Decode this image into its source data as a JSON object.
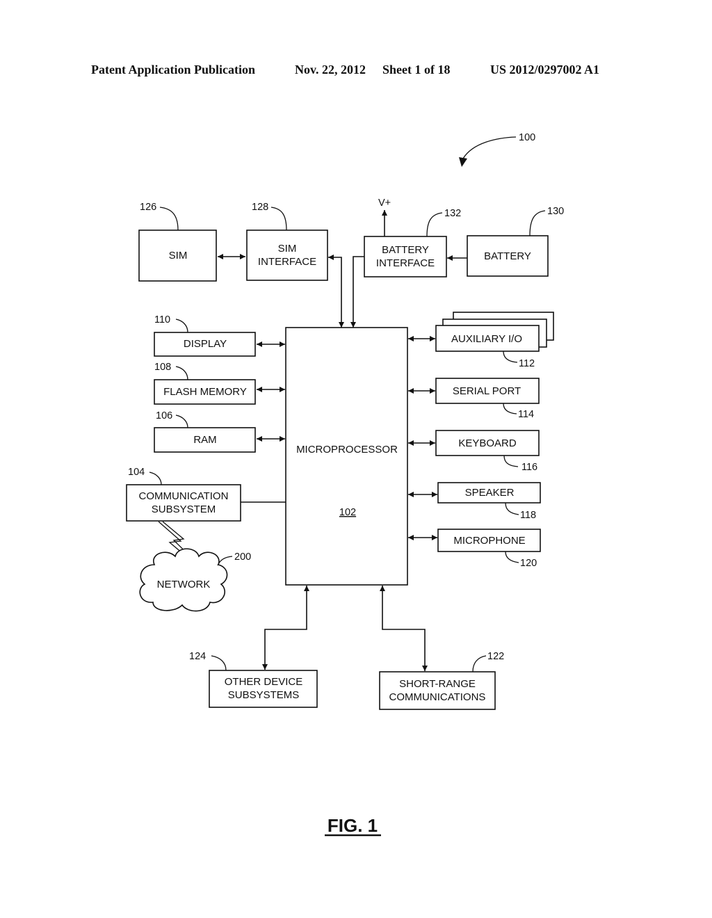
{
  "header": {
    "publication_type": "Patent Application Publication",
    "date": "Nov. 22, 2012",
    "sheet": "Sheet 1 of 18",
    "publication_number": "US 2012/0297002 A1"
  },
  "figure": {
    "title": "FIG. 1",
    "device_ref": "100",
    "power_label": "V+"
  },
  "blocks": {
    "sim": {
      "lines": [
        "SIM"
      ],
      "ref": "126"
    },
    "sim_interface": {
      "lines": [
        "SIM",
        "INTERFACE"
      ],
      "ref": "128"
    },
    "battery_interface": {
      "lines": [
        "BATTERY",
        "INTERFACE"
      ],
      "ref": "132"
    },
    "battery": {
      "lines": [
        "BATTERY"
      ],
      "ref": "130"
    },
    "display": {
      "lines": [
        "DISPLAY"
      ],
      "ref": "110"
    },
    "flash_memory": {
      "lines": [
        "FLASH MEMORY"
      ],
      "ref": "108"
    },
    "ram": {
      "lines": [
        "RAM"
      ],
      "ref": "106"
    },
    "communication_subsystem": {
      "lines": [
        "COMMUNICATION",
        "SUBSYSTEM"
      ],
      "ref": "104"
    },
    "network": {
      "lines": [
        "NETWORK"
      ],
      "ref": "200"
    },
    "microprocessor": {
      "lines": [
        "MICROPROCESSOR"
      ],
      "ref": "102"
    },
    "auxiliary_io": {
      "lines": [
        "AUXILIARY I/O"
      ],
      "ref": "112"
    },
    "serial_port": {
      "lines": [
        "SERIAL PORT"
      ],
      "ref": "114"
    },
    "keyboard": {
      "lines": [
        "KEYBOARD"
      ],
      "ref": "116"
    },
    "speaker": {
      "lines": [
        "SPEAKER"
      ],
      "ref": "118"
    },
    "microphone": {
      "lines": [
        "MICROPHONE"
      ],
      "ref": "120"
    },
    "other_device_subsystems": {
      "lines": [
        "OTHER DEVICE",
        "SUBSYSTEMS"
      ],
      "ref": "124"
    },
    "short_range_communications": {
      "lines": [
        "SHORT-RANGE",
        "COMMUNICATIONS"
      ],
      "ref": "122"
    }
  }
}
